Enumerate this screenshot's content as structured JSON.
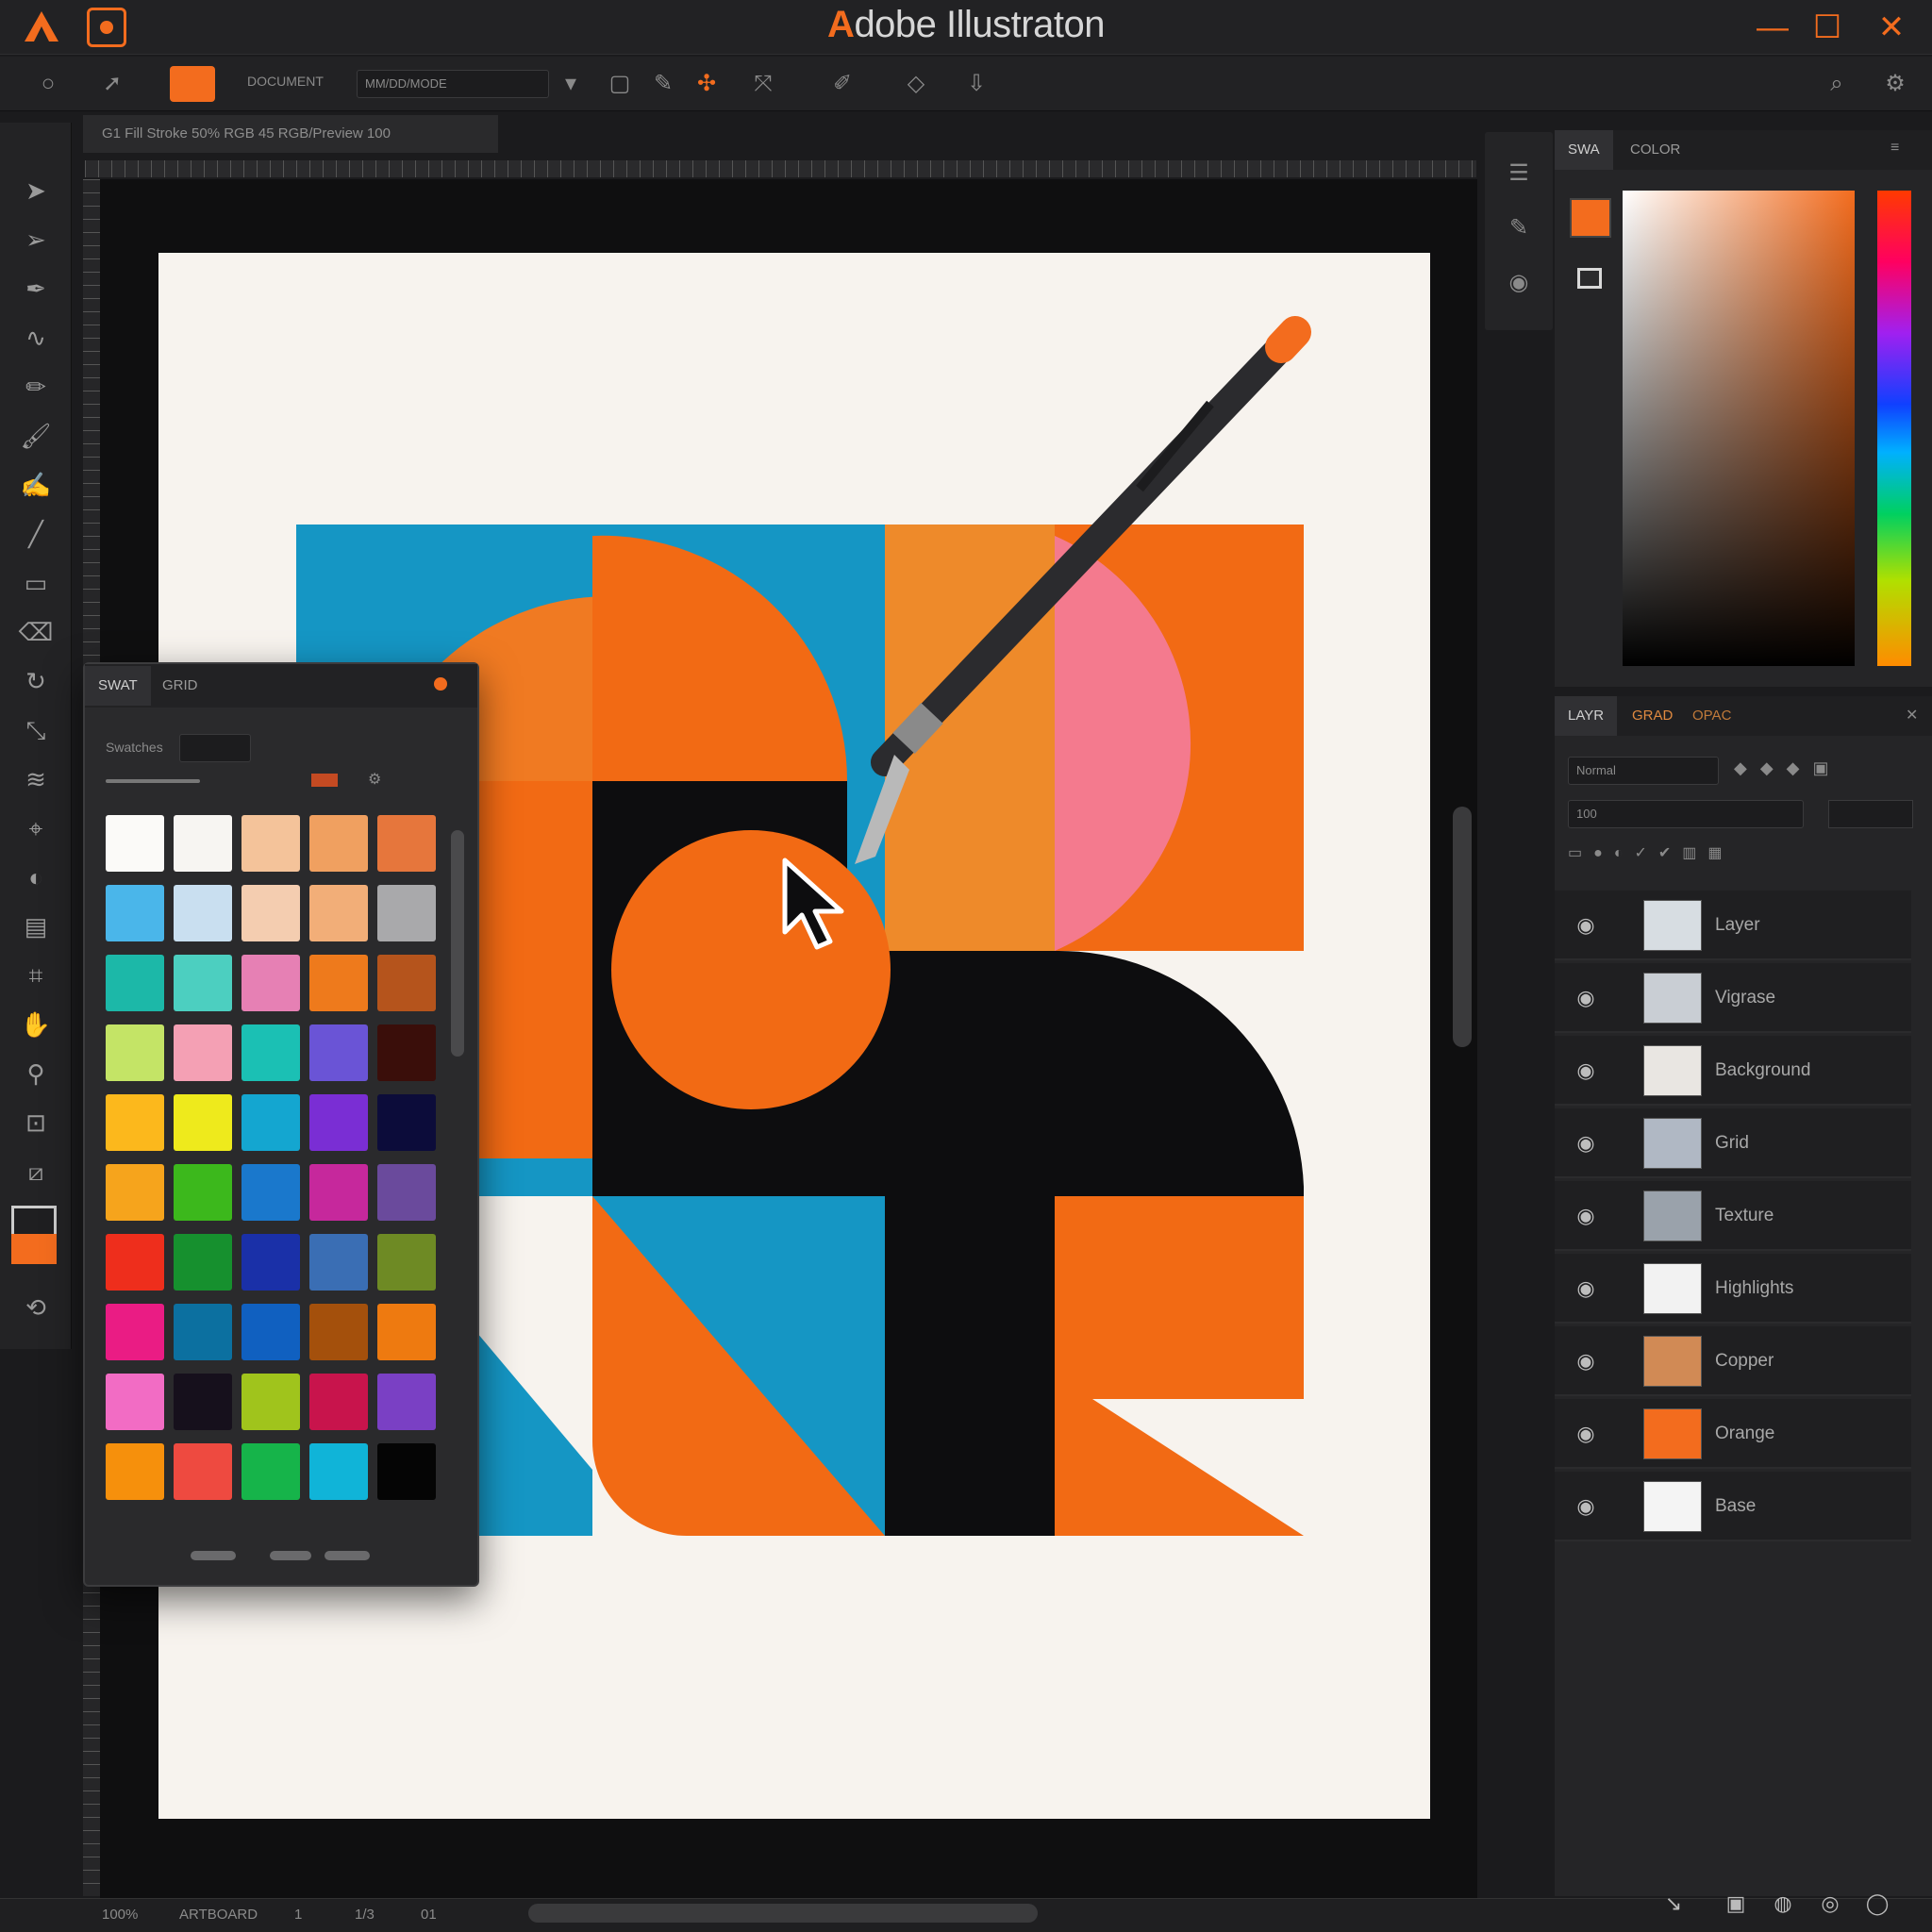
{
  "window": {
    "title_accent": "A",
    "title_rest": "dobe Illustraton",
    "minimize": "—",
    "maximize": "☐",
    "close": "✕"
  },
  "colors": {
    "accent": "#f36c1e",
    "blue": "#1596c4",
    "pink": "#f47a8e",
    "black": "#0d0d0f",
    "paper": "#f7f3ee",
    "ui_dark": "#1b1b1d",
    "ui_panel": "#252527"
  },
  "control_bar": {
    "label_1": "DOCUMENT",
    "field_1": "MM/DD/MODE",
    "icons": [
      "circle-icon",
      "arrow-icon",
      "rect-icon",
      "pen-icon",
      "anchor-icon",
      "transform-icon",
      "brush-icon",
      "diamond-icon",
      "download-icon",
      "search-icon",
      "settings-icon"
    ]
  },
  "doc_tab": {
    "label": "G1 Fill Stroke 50% RGB 45 RGB/Preview 100"
  },
  "color_panel": {
    "tab_1": "SWA",
    "tab_2": "COLOR"
  },
  "layers_panel": {
    "tab_1": "LAYR",
    "tab_2": "GRAD",
    "tab_3": "OPAC",
    "field_1": "Normal",
    "field_2": "100",
    "layers": [
      {
        "name": "Layer",
        "thumb": "#d7dde2"
      },
      {
        "name": "Vigrase",
        "thumb": "#c9ced4"
      },
      {
        "name": "Background",
        "thumb": "#e9e6e2"
      },
      {
        "name": "Grid",
        "thumb": "#b0b8c4"
      },
      {
        "name": "Texture",
        "thumb": "#9aa2ab"
      },
      {
        "name": "Highlights",
        "thumb": "#f2f2f2"
      },
      {
        "name": "Copper",
        "thumb": "#d18a55"
      },
      {
        "name": "Orange",
        "thumb": "#f36c1e"
      },
      {
        "name": "Base",
        "thumb": "#f4f4f4"
      }
    ]
  },
  "swatch_panel": {
    "tab_1": "SWAT",
    "tab_2": "GRID",
    "search_label": "Swatches",
    "rows": [
      [
        "#fbfaf8",
        "#f7f5f2",
        "#f4c39a",
        "#f0a060",
        "#e6763c"
      ],
      [
        "#4ab6ea",
        "#c9dff0",
        "#f4cdb0",
        "#f2ae78",
        "#a9a9ab"
      ],
      [
        "#1cb8a8",
        "#4ccfc0",
        "#e680b4",
        "#ee7a1c",
        "#b5541c"
      ],
      [
        "#c4e466",
        "#f4a0b4",
        "#1bc0b4",
        "#6a54d6",
        "#3a0e0a"
      ],
      [
        "#fcb81c",
        "#eeea1c",
        "#14a6d0",
        "#7a2ed4",
        "#0c0c3a"
      ],
      [
        "#f6a41c",
        "#3cb81c",
        "#1a78cc",
        "#c6289c",
        "#6a4a9c"
      ],
      [
        "#ee2e1c",
        "#16902e",
        "#1a30a8",
        "#3a6eb4",
        "#6e8a24"
      ],
      [
        "#ea1c84",
        "#0c70a0",
        "#1060c0",
        "#a4500c",
        "#ee7a10"
      ],
      [
        "#f26cc4",
        "#16101c",
        "#a0c41c",
        "#c8144c",
        "#7a40c4"
      ],
      [
        "#f6900c",
        "#ee4a40",
        "#16b44a",
        "#10b4d8",
        "#050505"
      ]
    ]
  },
  "status_bar": {
    "zoom": "100%",
    "artboard": "ARTBOARD",
    "item_1": "1",
    "item_2": "1/3",
    "item_3": "01"
  }
}
